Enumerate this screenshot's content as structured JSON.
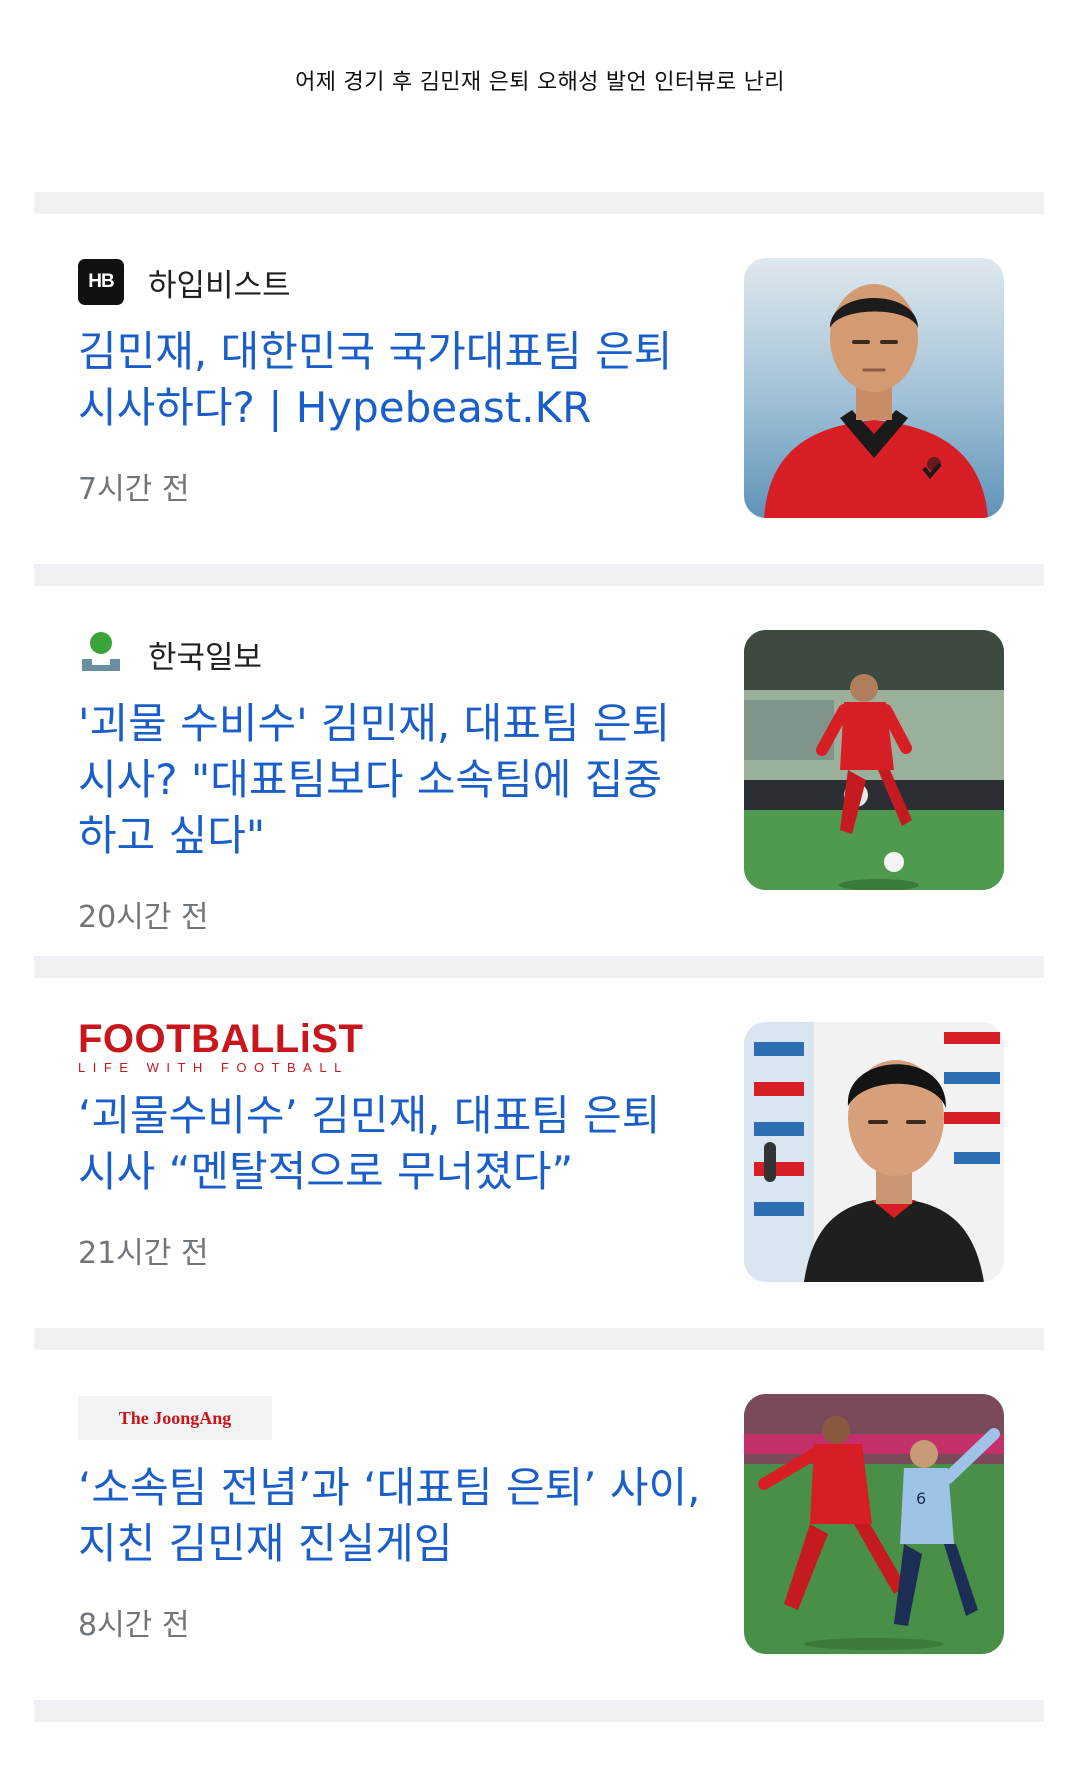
{
  "page_title": "어제 경기 후 김민재 은퇴 오해성 발언 인터뷰로 난리",
  "articles": [
    {
      "source": "하입비스트",
      "logo_text": "HB",
      "headline_1": "김민재, 대한민국 국가대표팀 은퇴",
      "headline_2": "시사하다? | Hypebeast.KR",
      "headline_3": "",
      "time": "7시간 전",
      "thumb_icon": "player-portrait-image"
    },
    {
      "source": "한국일보",
      "logo_text": "",
      "headline_1": "'괴물 수비수' 김민재, 대표팀 은퇴",
      "headline_2": "시사? \"대표팀보다 소속팀에 집중",
      "headline_3": "하고 싶다\"",
      "time": "20시간 전",
      "thumb_icon": "player-dribbling-image"
    },
    {
      "source": "",
      "logo_text": "FOOTBALLiST",
      "logo_subtext": "LIFE WITH FOOTBALL",
      "headline_1": "‘괴물수비수’ 김민재, 대표팀 은퇴",
      "headline_2": "시사 “멘탈적으로 무너졌다”",
      "headline_3": "",
      "time": "21시간 전",
      "thumb_icon": "press-conference-image"
    },
    {
      "source": "",
      "logo_text": "The JoongAng",
      "headline_1": "‘소속팀 전념’과 ‘대표팀 은퇴’ 사이,",
      "headline_2": "지친 김민재 진실게임",
      "headline_3": "",
      "time": "8시간 전",
      "thumb_icon": "match-tackle-image"
    }
  ],
  "colors": {
    "headline": "#1a5fc9",
    "meta": "#70757a",
    "separator": "#eef0f3",
    "footballist_red": "#c8161d",
    "joongang_red": "#c8161d",
    "hankook_green": "#3aa33a"
  }
}
